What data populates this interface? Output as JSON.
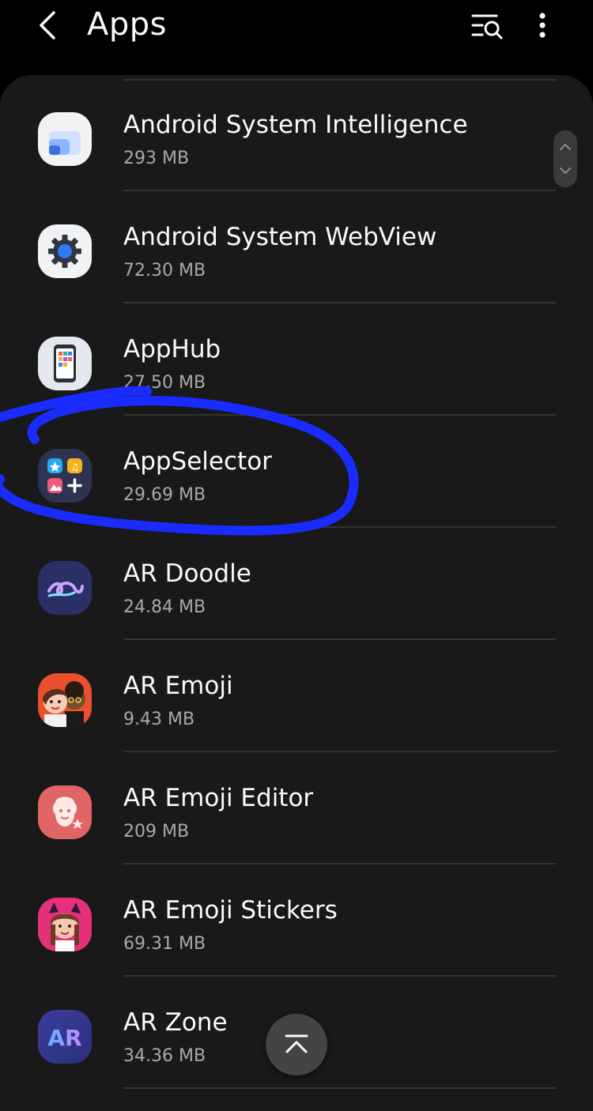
{
  "header": {
    "title": "Apps"
  },
  "apps": [
    {
      "name": "Android System Intelligence",
      "size": "293 MB",
      "icon": "android-system-intelligence-icon"
    },
    {
      "name": "Android System WebView",
      "size": "72.30 MB",
      "icon": "gear-icon"
    },
    {
      "name": "AppHub",
      "size": "27.50 MB",
      "icon": "apphub-icon"
    },
    {
      "name": "AppSelector",
      "size": "29.69 MB",
      "icon": "appselector-icon"
    },
    {
      "name": "AR Doodle",
      "size": "24.84 MB",
      "icon": "ar-doodle-icon"
    },
    {
      "name": "AR Emoji",
      "size": "9.43 MB",
      "icon": "ar-emoji-icon"
    },
    {
      "name": "AR Emoji Editor",
      "size": "209 MB",
      "icon": "ar-emoji-editor-icon"
    },
    {
      "name": "AR Emoji Stickers",
      "size": "69.31 MB",
      "icon": "ar-emoji-stickers-icon"
    },
    {
      "name": "AR Zone",
      "size": "34.36 MB",
      "icon": "ar-zone-icon",
      "icon_text": "AR"
    }
  ],
  "colors": {
    "background": "#000000",
    "panel": "#191919",
    "annotation": "#1a2bff",
    "secondary_text": "#a9a9a9"
  }
}
